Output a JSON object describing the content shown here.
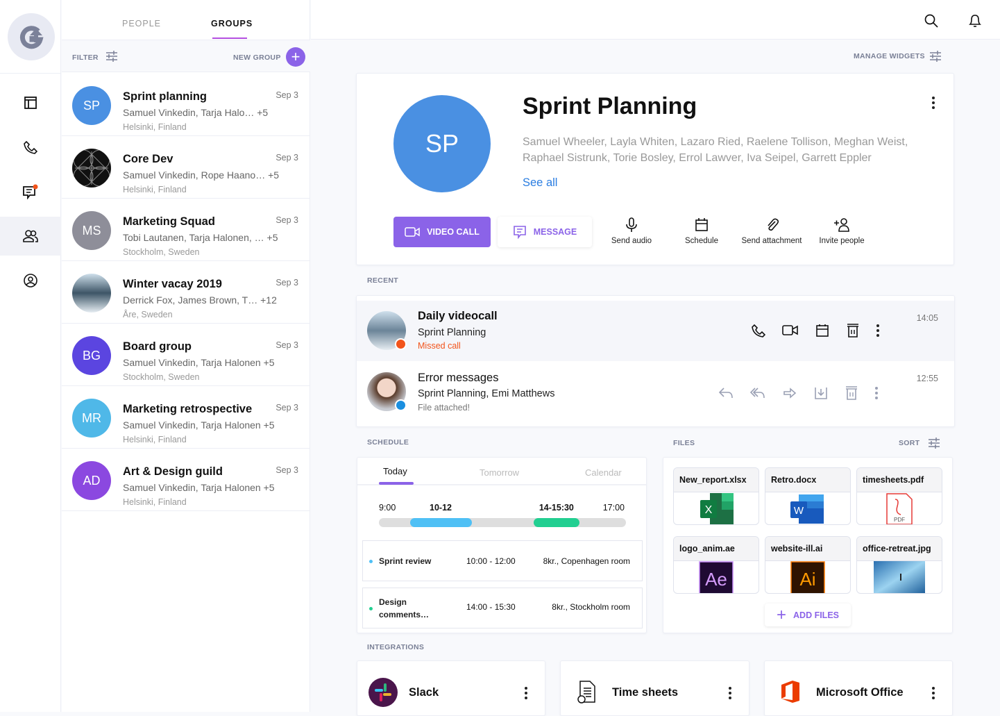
{
  "colors": {
    "accent": "#8b63e8",
    "missed": "#f2541b",
    "blue": "#4a90e2",
    "green": "#22cf91",
    "sky": "#4fc0f5"
  },
  "tabs": [
    {
      "label": "PEOPLE",
      "active": false
    },
    {
      "label": "GROUPS",
      "active": true
    }
  ],
  "filter_label": "FILTER",
  "new_group_label": "NEW GROUP",
  "rail": [
    "layout-icon",
    "phone-icon",
    "chat-icon",
    "groups-icon",
    "user-icon"
  ],
  "groups": [
    {
      "initials": "SP",
      "name": "Sprint planning",
      "members": "Samuel Vinkedin, Tarja Halo… +5",
      "location": "Helsinki, Finland",
      "date": "Sep 3",
      "color": "#4a90e2"
    },
    {
      "initials": "",
      "name": "Core Dev",
      "members": "Samuel Vinkedin, Rope Haano… +5",
      "location": "Helsinki, Finland",
      "date": "Sep 3",
      "color": "#111111"
    },
    {
      "initials": "MS",
      "name": "Marketing Squad",
      "members": "Tobi Lautanen, Tarja Halonen, … +5",
      "location": "Stockholm, Sweden",
      "date": "Sep 3",
      "color": "#8e8e99"
    },
    {
      "initials": "",
      "name": "Winter vacay 2019",
      "members": "Derrick Fox, James Brown, T… +12",
      "location": "Åre, Sweden",
      "date": "Sep 3",
      "color": "#9fb7c9"
    },
    {
      "initials": "BG",
      "name": "Board group",
      "members": "Samuel Vinkedin, Tarja Halonen +5",
      "location": "Stockholm, Sweden",
      "date": "Sep 3",
      "color": "#5b45e0"
    },
    {
      "initials": "MR",
      "name": "Marketing retrospective",
      "members": "Samuel Vinkedin, Tarja Halonen +5",
      "location": "Helsinki, Finland",
      "date": "Sep 3",
      "color": "#4fb8e8"
    },
    {
      "initials": "AD",
      "name": "Art & Design guild",
      "members": "Samuel Vinkedin, Tarja Halonen +5",
      "location": "Helsinki, Finland",
      "date": "Sep 3",
      "color": "#8b48e0"
    }
  ],
  "manage_widgets": "MANAGE WIDGETS",
  "profile": {
    "initials": "SP",
    "title": "Sprint Planning",
    "members": "Samuel Wheeler, Layla Whiten, Lazaro Ried, Raelene Tollison, Meghan Weist, Raphael Sistrunk, Torie Bosley, Errol Lawver, Iva Seipel, Garrett Eppler",
    "see_all": "See all",
    "video_call": "VIDEO CALL",
    "message": "MESSAGE",
    "actions": [
      {
        "label": "Send audio",
        "icon": "microphone-icon"
      },
      {
        "label": "Schedule",
        "icon": "calendar-icon"
      },
      {
        "label": "Send attachment",
        "icon": "paperclip-icon"
      },
      {
        "label": "Invite people",
        "icon": "add-person-icon"
      }
    ]
  },
  "recent": {
    "label": "RECENT",
    "items": [
      {
        "title": "Daily videocall",
        "sub": "Sprint Planning",
        "status": "Missed call",
        "time": "14:05"
      },
      {
        "title": "Error messages",
        "sub": "Sprint Planning, Emi Matthews",
        "status": "File attached!",
        "time": "12:55"
      }
    ]
  },
  "schedule": {
    "label": "SCHEDULE",
    "tabs": [
      "Today",
      "Tomorrow",
      "Calendar"
    ],
    "start": "9:00",
    "end": "17:00",
    "slots": [
      {
        "label": "10-12",
        "from": 10,
        "to": 12,
        "color": "#4fc0f5"
      },
      {
        "label": "14-15:30",
        "from": 14,
        "to": 15.5,
        "color": "#22cf91"
      }
    ],
    "events": [
      {
        "name": "Sprint review",
        "time": "10:00 - 12:00",
        "room": "8kr., Copenhagen room",
        "color": "#4fc0f5"
      },
      {
        "name": "Design comments…",
        "time": "14:00 - 15:30",
        "room": "8kr., Stockholm room",
        "color": "#22cf91"
      }
    ]
  },
  "files": {
    "label": "FILES",
    "sort": "SORT",
    "add": "ADD FILES",
    "items": [
      {
        "name": "New_report.xlsx",
        "type": "excel"
      },
      {
        "name": "Retro.docx",
        "type": "word"
      },
      {
        "name": "timesheets.pdf",
        "type": "pdf"
      },
      {
        "name": "logo_anim.ae",
        "type": "ae"
      },
      {
        "name": "website-ill.ai",
        "type": "ai"
      },
      {
        "name": "office-retreat.jpg",
        "type": "photo"
      }
    ]
  },
  "integrations": {
    "label": "INTEGRATIONS",
    "items": [
      {
        "name": "Slack"
      },
      {
        "name": "Time sheets"
      },
      {
        "name": "Microsoft Office"
      }
    ]
  }
}
